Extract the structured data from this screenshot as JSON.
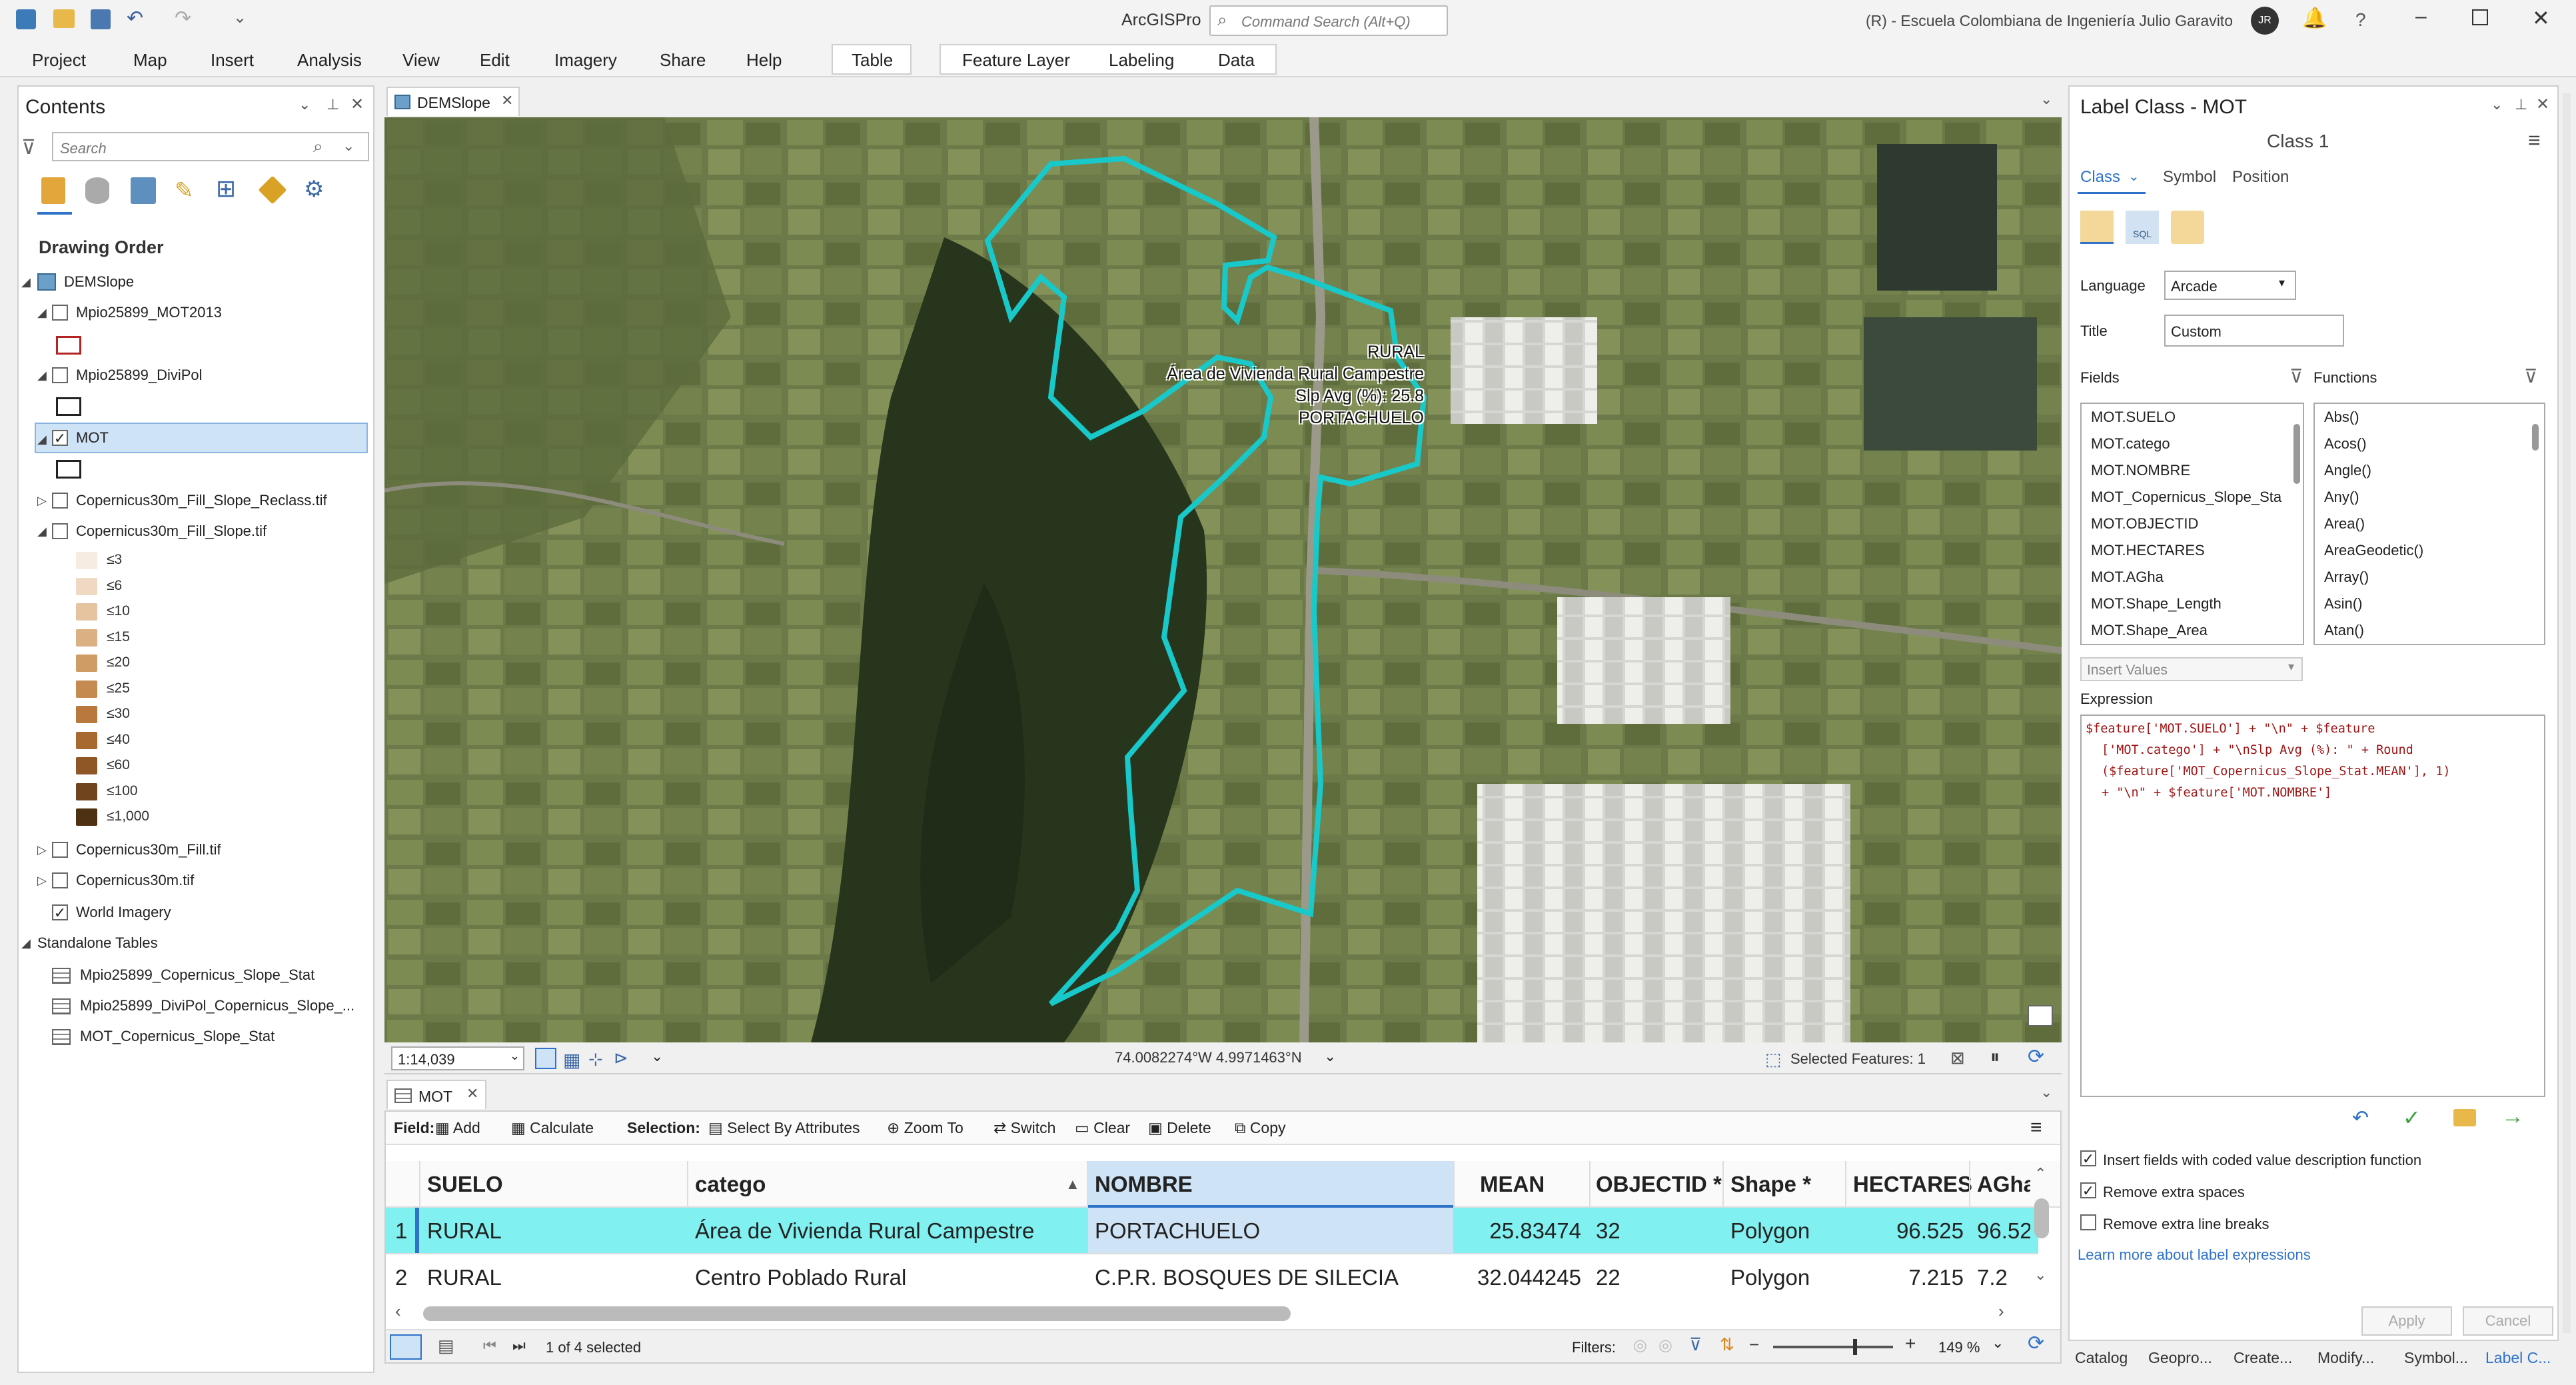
{
  "app": {
    "title": "ArcGISPro",
    "search_placeholder": "Command Search (Alt+Q)",
    "org": "(R) - Escuela Colombiana de Ingeniería Julio Garavito",
    "user_initials": "JR",
    "help": "?"
  },
  "ribbon": {
    "tabs": [
      "Project",
      "Map",
      "Insert",
      "Analysis",
      "View",
      "Edit",
      "Imagery",
      "Share",
      "Help",
      "Table",
      "Feature Layer",
      "Labeling",
      "Data"
    ]
  },
  "contents": {
    "title": "Contents",
    "search_placeholder": "Search",
    "drawing_order": "Drawing Order",
    "layers": [
      {
        "label": "DEMSlope",
        "checked": true
      },
      {
        "label": "Mpio25899_MOT2013",
        "checked": false
      },
      {
        "label": "Mpio25899_DiviPol",
        "checked": false
      },
      {
        "label": "MOT",
        "checked": true
      },
      {
        "label": "Copernicus30m_Fill_Slope_Reclass.tif",
        "checked": false
      },
      {
        "label": "Copernicus30m_Fill_Slope.tif",
        "checked": false
      },
      {
        "label": "Copernicus30m_Fill.tif",
        "checked": false
      },
      {
        "label": "Copernicus30m.tif",
        "checked": false
      },
      {
        "label": "World Imagery",
        "checked": true
      }
    ],
    "legend": [
      {
        "label": "≤3",
        "color": "#f7ece2"
      },
      {
        "label": "≤6",
        "color": "#f0d9c2"
      },
      {
        "label": "≤10",
        "color": "#e6c4a0"
      },
      {
        "label": "≤15",
        "color": "#dbb083"
      },
      {
        "label": "≤20",
        "color": "#cf9c66"
      },
      {
        "label": "≤25",
        "color": "#c48a4f"
      },
      {
        "label": "≤30",
        "color": "#b9793c"
      },
      {
        "label": "≤40",
        "color": "#a7692f"
      },
      {
        "label": "≤60",
        "color": "#8e5725"
      },
      {
        "label": "≤100",
        "color": "#70441c"
      },
      {
        "label": "≤1,000",
        "color": "#4e3013"
      }
    ],
    "standalone_title": "Standalone Tables",
    "tables": [
      "Mpio25899_Copernicus_Slope_Stat",
      "Mpio25899_DiviPol_Copernicus_Slope_...",
      "MOT_Copernicus_Slope_Stat"
    ]
  },
  "map": {
    "tab": "DEMSlope",
    "label_lines": [
      "RURAL",
      "Área de Vivienda Rural Campestre",
      "Slp Avg (%): 25.8",
      "PORTACHUELO"
    ],
    "scale": "1:14,039",
    "coords": "74.0082274°W 4.9971463°N",
    "selected": "Selected Features: 1"
  },
  "table": {
    "tab": "MOT",
    "field_label": "Field:",
    "add": "Add",
    "calculate": "Calculate",
    "selection_label": "Selection:",
    "select_by_attr": "Select By Attributes",
    "zoom_to": "Zoom To",
    "switch": "Switch",
    "clear": "Clear",
    "delete": "Delete",
    "copy": "Copy",
    "columns": [
      "SUELO",
      "catego",
      "NOMBRE",
      "MEAN",
      "OBJECTID *",
      "Shape *",
      "HECTARES",
      "AGha"
    ],
    "rows": [
      {
        "n": "1",
        "SUELO": "RURAL",
        "catego": "Área de Vivienda Rural Campestre",
        "NOMBRE": "PORTACHUELO",
        "MEAN": "25.83474",
        "OBJECTID": "32",
        "Shape": "Polygon",
        "HECTARES": "96.525",
        "AGha": "96.52"
      },
      {
        "n": "2",
        "SUELO": "RURAL",
        "catego": "Centro Poblado Rural",
        "NOMBRE": "C.P.R. BOSQUES DE SILECIA",
        "MEAN": "32.044245",
        "OBJECTID": "22",
        "Shape": "Polygon",
        "HECTARES": "7.215",
        "AGha": "7.2"
      }
    ],
    "status": "1 of 4 selected",
    "filters": "Filters:",
    "zoom": "149 %"
  },
  "label_class": {
    "title": "Label Class - MOT",
    "class_name": "Class 1",
    "tabs": [
      "Class",
      "Symbol",
      "Position"
    ],
    "language_label": "Language",
    "language": "Arcade",
    "title_label": "Title",
    "title_value": "Custom",
    "fields_label": "Fields",
    "functions_label": "Functions",
    "fields": [
      "MOT.SUELO",
      "MOT.catego",
      "MOT.NOMBRE",
      "MOT_Copernicus_Slope_Sta",
      "MOT.OBJECTID",
      "MOT.HECTARES",
      "MOT.AGha",
      "MOT.Shape_Length",
      "MOT.Shape_Area"
    ],
    "functions": [
      "Abs()",
      "Acos()",
      "Angle()",
      "Any()",
      "Area()",
      "AreaGeodetic()",
      "Array()",
      "Asin()",
      "Atan()"
    ],
    "insert_values": "Insert Values",
    "expression_label": "Expression",
    "expression_lines": [
      "$feature['MOT.SUELO'] + \"\\n\" + $feature",
      "['MOT.catego'] + \"\\nSlp Avg (%): \" + Round",
      "($feature['MOT_Copernicus_Slope_Stat.MEAN'], 1)",
      "+ \"\\n\" + $feature['MOT.NOMBRE']"
    ],
    "opt1": "Insert fields with coded value description function",
    "opt2": "Remove extra spaces",
    "opt3": "Remove extra line breaks",
    "learn_more": "Learn more about label expressions",
    "apply": "Apply",
    "cancel": "Cancel"
  },
  "bottom_tabs": [
    "Catalog",
    "Geopro...",
    "Create...",
    "Modify...",
    "Symbol...",
    "Label C..."
  ]
}
